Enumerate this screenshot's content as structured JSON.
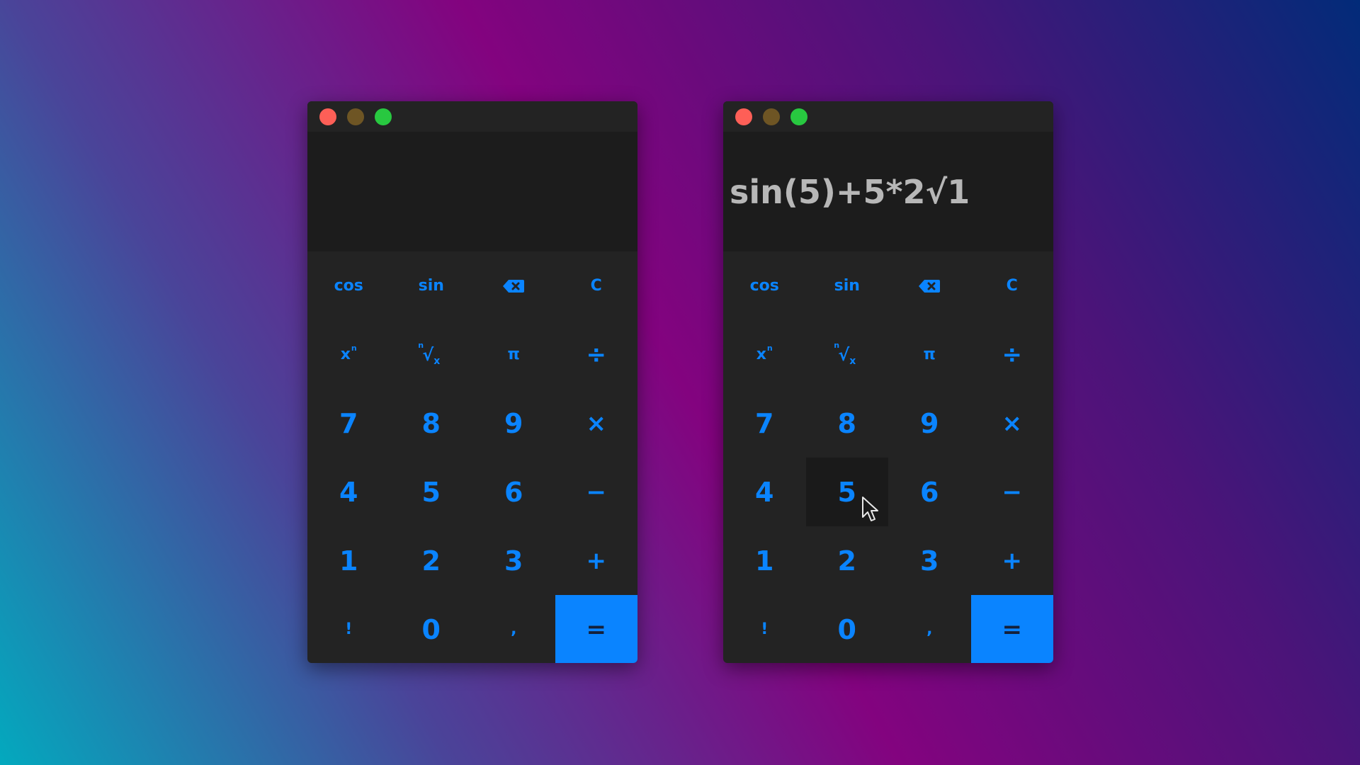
{
  "colors": {
    "accent": "#0a84ff",
    "window_bg": "#232323",
    "display_bg": "#1c1c1c",
    "expression_text": "#b7b7b7",
    "close_dot": "#fe5f57",
    "minimize_dot": "#6e5524",
    "maximize_dot": "#28c840"
  },
  "windows": [
    {
      "expression": ""
    },
    {
      "expression": "sin(5)+5*2√1",
      "hovered_key": "5"
    }
  ],
  "keys": {
    "cos": "cos",
    "sin": "sin",
    "backspace_icon": "backspace-icon",
    "clear": "C",
    "power_base": "x",
    "power_exp": "n",
    "root_index": "n",
    "root_sign": "√",
    "root_radicand": "x",
    "pi": "π",
    "divide": "÷",
    "seven": "7",
    "eight": "8",
    "nine": "9",
    "multiply": "×",
    "four": "4",
    "five": "5",
    "six": "6",
    "minus": "−",
    "one": "1",
    "two": "2",
    "three": "3",
    "plus": "+",
    "factorial": "!",
    "zero": "0",
    "comma": ",",
    "equals": "="
  },
  "cursor_icon": "arrow-cursor-icon"
}
